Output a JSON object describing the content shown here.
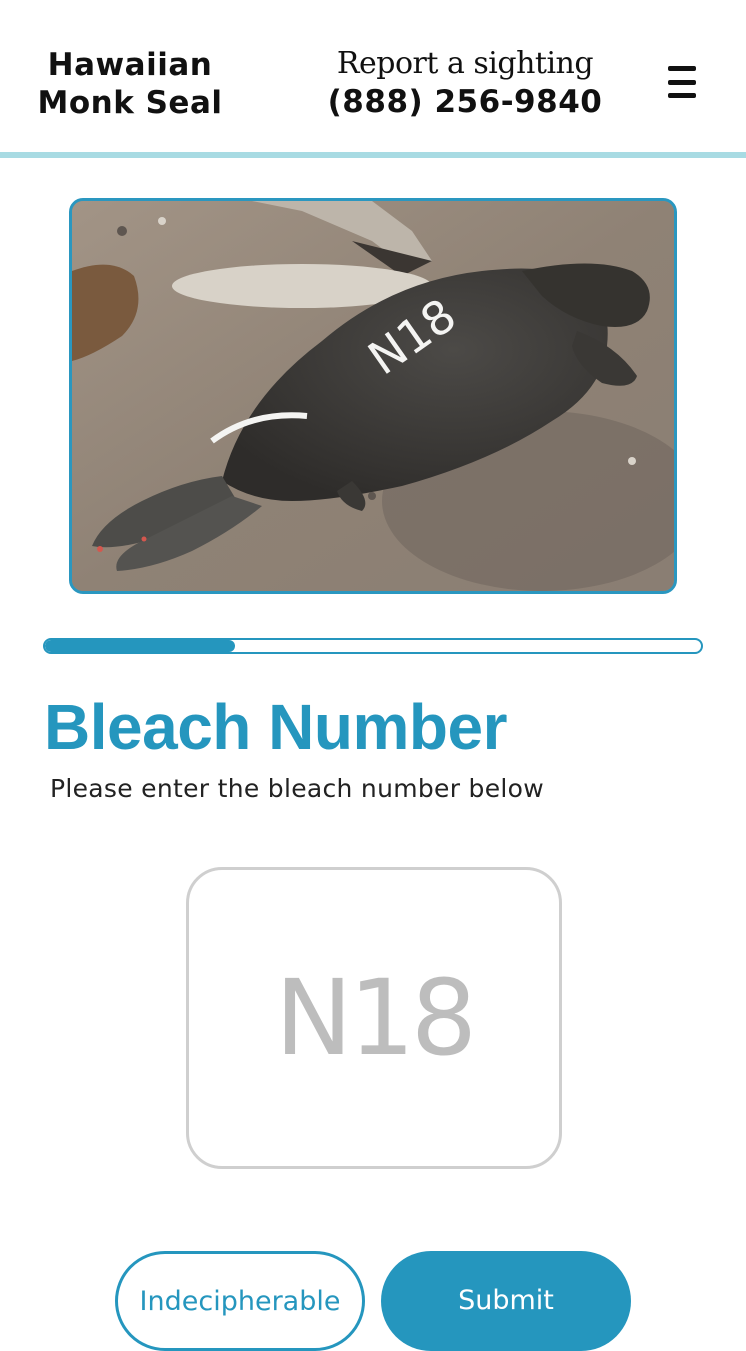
{
  "header": {
    "brand_line1": "Hawaiian",
    "brand_line2": "Monk Seal",
    "report_label": "Report a sighting",
    "report_phone": "(888) 256-9840",
    "menu_icon": "hamburger-menu-icon"
  },
  "photo": {
    "subject": "seal-photo",
    "bleach_mark": "N18"
  },
  "progress": {
    "fraction": 0.29
  },
  "form": {
    "title": "Bleach Number",
    "instructions": "Please enter the bleach number below",
    "bleach_value": "N18",
    "indecipherable_label": "Indecipherable",
    "submit_label": "Submit"
  },
  "colors": {
    "accent": "#2596be",
    "header_rule": "#a8dbe3",
    "input_border": "#cfcfcf",
    "input_text": "#bdbdbd"
  }
}
